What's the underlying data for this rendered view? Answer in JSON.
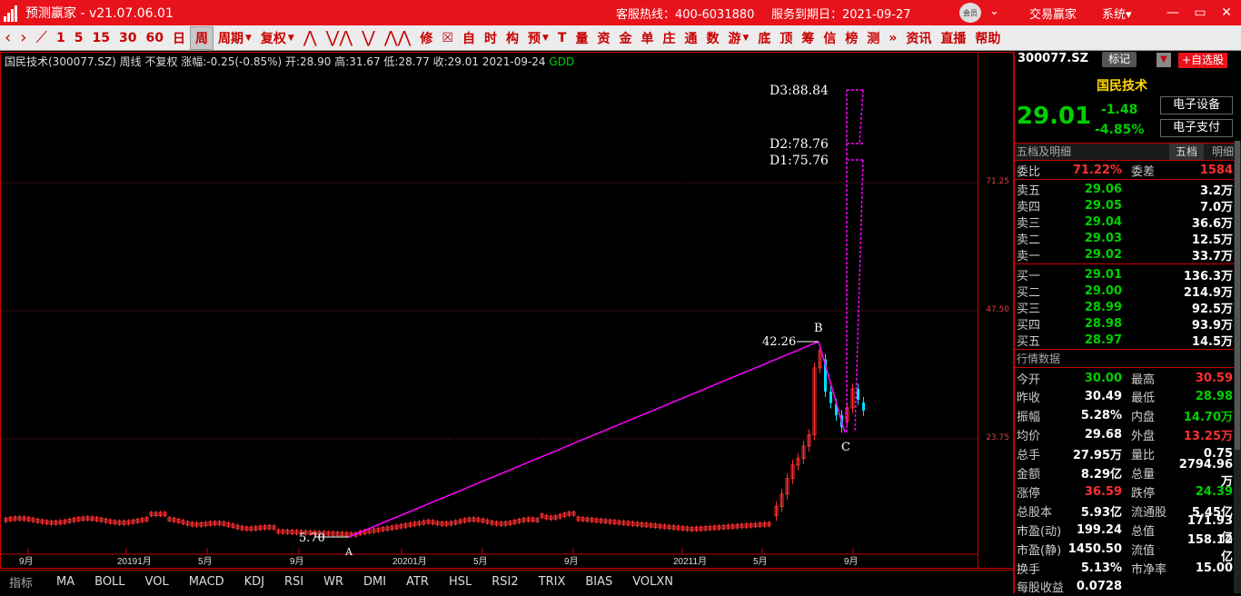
{
  "titlebar": {
    "app_title": "预测赢家 - v21.07.06.01",
    "hotline": "客服热线：400-6031880",
    "service_end": "服务到期日：2021-09-27",
    "avatar_text": "会员",
    "trade": "交易赢家",
    "system": "系统",
    "system_dropdown": "▾",
    "minimize": "—",
    "maximize": "▭",
    "close": "✕"
  },
  "toolbar": {
    "items": [
      {
        "label": "‹",
        "type": "arrow",
        "name": "back-button"
      },
      {
        "label": "›",
        "type": "arrow",
        "name": "forward-button"
      },
      {
        "label": "⟋",
        "type": "arrow",
        "name": "line-icon"
      },
      {
        "label": "1",
        "name": "period-1"
      },
      {
        "label": "5",
        "name": "period-5"
      },
      {
        "label": "15",
        "name": "period-15"
      },
      {
        "label": "30",
        "name": "period-30"
      },
      {
        "label": "60",
        "name": "period-60"
      },
      {
        "label": "日",
        "name": "period-day"
      },
      {
        "label": "周",
        "name": "period-week",
        "selected": true
      },
      {
        "label": "周期",
        "name": "period-menu",
        "dropdown": true
      },
      {
        "label": "复权",
        "name": "adjust-menu",
        "dropdown": true
      },
      {
        "label": "⋀",
        "type": "arrow",
        "name": "pattern-1-icon"
      },
      {
        "label": "⋁⋀",
        "type": "arrow",
        "name": "pattern-2-icon"
      },
      {
        "label": "⋁",
        "type": "arrow",
        "name": "pattern-3-icon"
      },
      {
        "label": "⋀⋀",
        "type": "arrow",
        "name": "pattern-4-icon"
      },
      {
        "label": "修",
        "name": "modify-button"
      },
      {
        "label": "☒",
        "name": "delete-icon"
      },
      {
        "label": "自",
        "name": "self-button"
      },
      {
        "label": "时",
        "name": "time-button"
      },
      {
        "label": "构",
        "name": "structure-button"
      },
      {
        "label": "预",
        "name": "predict-menu",
        "dropdown": true
      },
      {
        "label": "T",
        "name": "t-button"
      },
      {
        "label": "量",
        "name": "volume-button"
      },
      {
        "label": "资",
        "name": "funds-button"
      },
      {
        "label": "金",
        "name": "gold-button"
      },
      {
        "label": "单",
        "name": "order-button"
      },
      {
        "label": "庄",
        "name": "dealer-button"
      },
      {
        "label": "通",
        "name": "channel-button"
      },
      {
        "label": "数",
        "name": "data-button"
      },
      {
        "label": "游",
        "name": "swim-menu",
        "dropdown": true
      },
      {
        "label": "底",
        "name": "bottom-button"
      },
      {
        "label": "顶",
        "name": "top-button"
      },
      {
        "label": "筹",
        "name": "chips-button"
      },
      {
        "label": "信",
        "name": "signal-button"
      },
      {
        "label": "榜",
        "name": "rank-button"
      },
      {
        "label": "测",
        "name": "test-button"
      },
      {
        "label": "»",
        "name": "more-button"
      },
      {
        "label": "资讯",
        "name": "news-button"
      },
      {
        "label": "直播",
        "name": "live-button"
      },
      {
        "label": "帮助",
        "name": "help-button"
      }
    ]
  },
  "chart": {
    "stock_line": "国民技术(300077.SZ) 周线 不复权 涨幅:-0.25(-0.85%) 开:28.90 高:31.67 低:28.77 收:29.01 2021-09-24",
    "gdd": "GDD",
    "labels": {
      "D3": "D3:88.84",
      "D2": "D2:78.76",
      "D1": "D1:75.76",
      "B_val": "42.26",
      "B": "B",
      "A_val": "5.70",
      "A": "A",
      "C": "C"
    },
    "x_ticks": [
      "9月",
      "20191月",
      "5月",
      "9月",
      "20201月",
      "5月",
      "9月",
      "20211月",
      "5月",
      "9月"
    ]
  },
  "price_axis": {
    "ticks": [
      "71.25",
      "47.50",
      "23.75"
    ]
  },
  "quote": {
    "code": "300077.SZ",
    "tag": "标记",
    "add_watch": "+自选股",
    "name": "国民技术",
    "price": "29.01",
    "change": "-1.48",
    "change_pct": "-4.85%",
    "sector1": "电子设备",
    "sector2": "电子支付",
    "order_book_title": "五档及明细",
    "tab1": "五档",
    "tab2": "明细",
    "wei_bi_label": "委比",
    "wei_bi": "71.22%",
    "wei_cha_label": "委差",
    "wei_cha": "1584",
    "sells": [
      {
        "label": "卖五",
        "price": "29.06",
        "vol": "3.2万"
      },
      {
        "label": "卖四",
        "price": "29.05",
        "vol": "7.0万"
      },
      {
        "label": "卖三",
        "price": "29.04",
        "vol": "36.6万"
      },
      {
        "label": "卖二",
        "price": "29.03",
        "vol": "12.5万"
      },
      {
        "label": "卖一",
        "price": "29.02",
        "vol": "33.7万"
      }
    ],
    "buys": [
      {
        "label": "买一",
        "price": "29.01",
        "vol": "136.3万"
      },
      {
        "label": "买二",
        "price": "29.00",
        "vol": "214.9万"
      },
      {
        "label": "买三",
        "price": "28.99",
        "vol": "92.5万"
      },
      {
        "label": "买四",
        "price": "28.98",
        "vol": "93.9万"
      },
      {
        "label": "买五",
        "price": "28.97",
        "vol": "14.5万"
      }
    ],
    "market_title": "行情数据",
    "stats": [
      {
        "l1": "今开",
        "v1": "30.00",
        "c1": "green",
        "l2": "最高",
        "v2": "30.59",
        "c2": "red"
      },
      {
        "l1": "昨收",
        "v1": "30.49",
        "c1": "white",
        "l2": "最低",
        "v2": "28.98",
        "c2": "green"
      },
      {
        "l1": "振幅",
        "v1": "5.28%",
        "c1": "white",
        "l2": "内盘",
        "v2": "14.70万",
        "c2": "green"
      },
      {
        "l1": "均价",
        "v1": "29.68",
        "c1": "white",
        "l2": "外盘",
        "v2": "13.25万",
        "c2": "red"
      },
      {
        "l1": "总手",
        "v1": "27.95万",
        "c1": "white",
        "l2": "量比",
        "v2": "0.75",
        "c2": "white"
      },
      {
        "l1": "金额",
        "v1": "8.29亿",
        "c1": "white",
        "l2": "总量",
        "v2": "2794.96万",
        "c2": "white"
      },
      {
        "l1": "涨停",
        "v1": "36.59",
        "c1": "red",
        "l2": "跌停",
        "v2": "24.39",
        "c2": "green"
      },
      {
        "l1": "总股本",
        "v1": "5.93亿",
        "c1": "white",
        "l2": "流通股",
        "v2": "5.45亿",
        "c2": "white"
      },
      {
        "l1": "市盈(动)",
        "v1": "199.24",
        "c1": "white",
        "l2": "总值",
        "v2": "171.93亿",
        "c2": "white"
      },
      {
        "l1": "市盈(静)",
        "v1": "1450.50",
        "c1": "white",
        "l2": "流值",
        "v2": "158.12亿",
        "c2": "white"
      },
      {
        "l1": "换手",
        "v1": "5.13%",
        "c1": "white",
        "l2": "市净率",
        "v2": "15.00",
        "c2": "white"
      },
      {
        "l1": "每股收益",
        "v1": "0.0728",
        "c1": "white",
        "l2": "",
        "v2": "",
        "c2": "white"
      }
    ]
  },
  "indicators": [
    "指标",
    "MA",
    "BOLL",
    "VOL",
    "MACD",
    "KDJ",
    "RSI",
    "WR",
    "DMI",
    "ATR",
    "HSL",
    "RSI2",
    "TRIX",
    "BIAS",
    "VOLXN"
  ]
}
